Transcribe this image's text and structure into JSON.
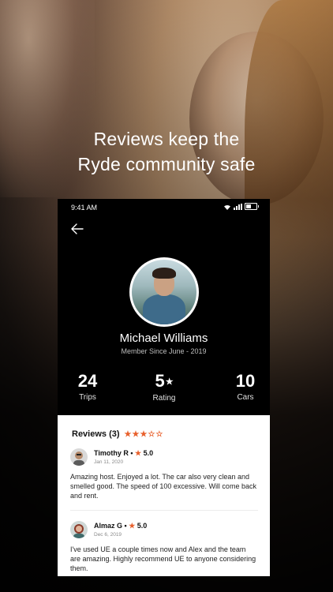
{
  "headline": {
    "line1": "Reviews keep the",
    "line2": "Ryde community safe"
  },
  "status_bar": {
    "time": "9:41 AM"
  },
  "profile": {
    "name": "Michael Williams",
    "member_since": "Member Since June - 2019"
  },
  "stats": [
    {
      "value": "24",
      "label": "Trips"
    },
    {
      "value": "5",
      "label": "Rating",
      "icon": "star-icon"
    },
    {
      "value": "10",
      "label": "Cars"
    }
  ],
  "reviews": {
    "title": "Reviews (3)",
    "star_rating": 3,
    "star_max": 5,
    "accent_color": "#e8602c",
    "items": [
      {
        "author": "Timothy R",
        "separator": "•",
        "rating": "5.0",
        "date": "Jan 11, 2020",
        "text": "Amazing host. Enjoyed a lot. The car also very clean and smelled good. The speed of 100 excessive. Will come back and rent."
      },
      {
        "author": "Almaz G",
        "separator": "•",
        "rating": "5.0",
        "date": "Dec 6, 2019",
        "text": "I've used UE a couple times now and Alex and the team are amazing. Highly recommend UE to anyone considering them."
      }
    ]
  }
}
